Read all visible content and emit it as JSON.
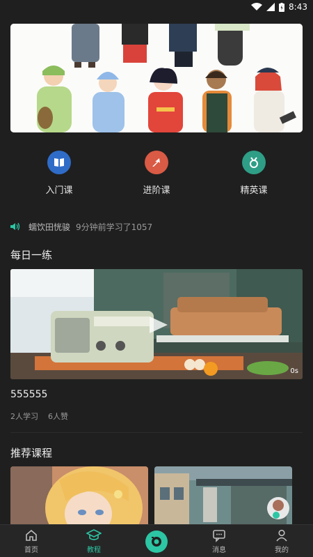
{
  "status_bar": {
    "time": "8:43"
  },
  "categories": [
    {
      "label": "入门课",
      "icon": "book-icon",
      "color": "#2f6cc8"
    },
    {
      "label": "进阶课",
      "icon": "arrow-up-icon",
      "color": "#d95a45"
    },
    {
      "label": "精英课",
      "icon": "medal-icon",
      "color": "#2f9e86"
    }
  ],
  "notice": {
    "user": "蠕饮田恍骏",
    "message": "9分钟前学习了1057"
  },
  "daily": {
    "title": "每日一练",
    "video": {
      "duration": "0s",
      "title": "555555",
      "learners": "2人学习",
      "likes": "6人赞"
    }
  },
  "recommended": {
    "title": "推荐课程"
  },
  "tabbar": {
    "items": [
      {
        "label": "首页",
        "icon": "home-icon"
      },
      {
        "label": "教程",
        "icon": "graduation-cap-icon"
      },
      {
        "label": "",
        "icon": "camera-icon"
      },
      {
        "label": "消息",
        "icon": "message-icon"
      },
      {
        "label": "我的",
        "icon": "profile-icon"
      }
    ],
    "active": "教程",
    "accent": "#2cc6a4"
  }
}
